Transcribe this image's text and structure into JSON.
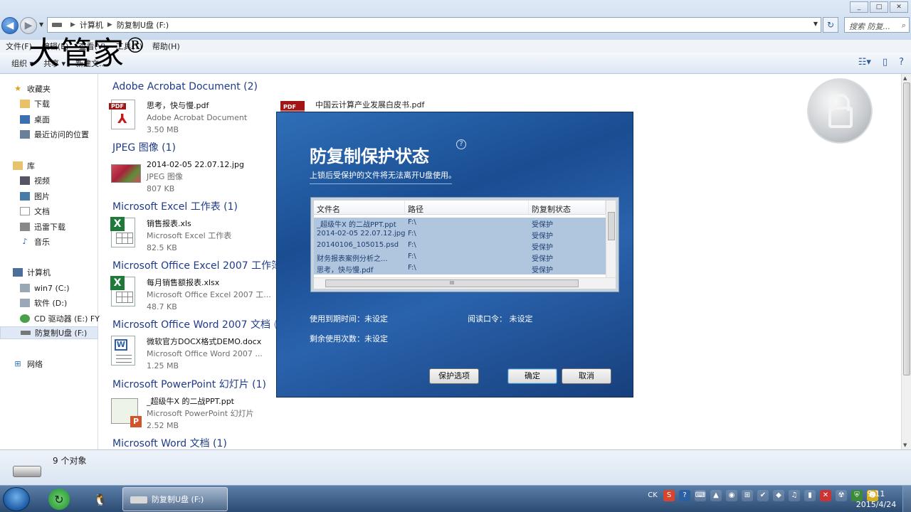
{
  "window": {
    "controls": [
      "_",
      "□",
      "✕"
    ]
  },
  "address": {
    "parts": [
      "计算机",
      "防复制U盘 (F:)"
    ],
    "search_placeholder": "搜索 防复..."
  },
  "menu": [
    "文件(F)",
    "编辑(E)",
    "查看(V)",
    "工具(T)",
    "帮助(H)"
  ],
  "toolbar": {
    "organize": "组织 ▾",
    "share": "共享 ▾",
    "burn": "新建文..."
  },
  "watermark": {
    "text": "大管家",
    "reg": "®"
  },
  "sidebar": {
    "favorites": "收藏夹",
    "downloads": "下载",
    "desktop": "桌面",
    "recent": "最近访问的位置",
    "libraries": "库",
    "videos": "视频",
    "pictures": "图片",
    "documents": "文档",
    "thunder": "迅雷下载",
    "music": "音乐",
    "computer": "计算机",
    "win7": "win7 (C:)",
    "soft": "软件 (D:)",
    "cd": "CD 驱动器 (E:) FY",
    "usb": "防复制U盘 (F:)",
    "network": "网络"
  },
  "groups": [
    {
      "title": "Adobe Acrobat Document (2)"
    },
    {
      "title": "JPEG 图像 (1)"
    },
    {
      "title": "Microsoft Excel 工作表 (1)"
    },
    {
      "title": "Microsoft Office Excel 2007 工作簿"
    },
    {
      "title": "Microsoft Office Word 2007 文档 ("
    },
    {
      "title": "Microsoft PowerPoint 幻灯片 (1)"
    },
    {
      "title": "Microsoft Word 文档 (1)"
    }
  ],
  "files": [
    {
      "name": "思考，快与慢.pdf",
      "type": "Adobe Acrobat Document",
      "size": "3.50 MB"
    },
    {
      "name": "2014-02-05 22.07.12.jpg",
      "type": "JPEG 图像",
      "size": "807 KB"
    },
    {
      "name": "销售报表.xls",
      "type": "Microsoft Excel 工作表",
      "size": "82.5 KB"
    },
    {
      "name": "每月销售额报表.xlsx",
      "type": "Microsoft Office Excel 2007 工...",
      "size": "48.7 KB"
    },
    {
      "name": "微软官方DOCX格式DEMO.docx",
      "type": "Microsoft Office Word 2007 ...",
      "size": "1.25 MB"
    },
    {
      "name": "_超级牛X 的二战PPT.ppt",
      "type": "Microsoft PowerPoint 幻灯片",
      "size": "2.52 MB"
    }
  ],
  "second_pdf": {
    "name": "中国云计算产业发展白皮书.pdf",
    "tag": "PDF"
  },
  "status": {
    "count": "9 个对象"
  },
  "dialog": {
    "title": "防复制保护状态",
    "help": "?",
    "subtitle": "上锁后受保护的文件将无法离开U盘使用。",
    "headers": [
      "文件名",
      "路径",
      "防复制状态"
    ],
    "rows": [
      [
        "_超级牛X 的二战PPT.ppt",
        "F:\\",
        "受保护"
      ],
      [
        "2014-02-05 22.07.12.jpg",
        "F:\\",
        "受保护"
      ],
      [
        "20140106_105015.psd",
        "F:\\",
        "受保护"
      ],
      [
        "财务报表案例分析之...",
        "F:\\",
        "受保护"
      ],
      [
        "思考，快与慢.pdf",
        "F:\\",
        "受保护"
      ]
    ],
    "hscroll_grip": "III",
    "expiry_label": "使用到期时间：未设定",
    "password_label": "阅读口令：  未设定",
    "remaining_label": "剩余使用次数：未设定",
    "btn_options": "保护选项",
    "btn_ok": "确定",
    "btn_cancel": "取消"
  },
  "taskbar": {
    "task_label": "防复制U盘 (F:)",
    "ime": "CK",
    "time": "9:11",
    "date": "2015/4/24"
  }
}
